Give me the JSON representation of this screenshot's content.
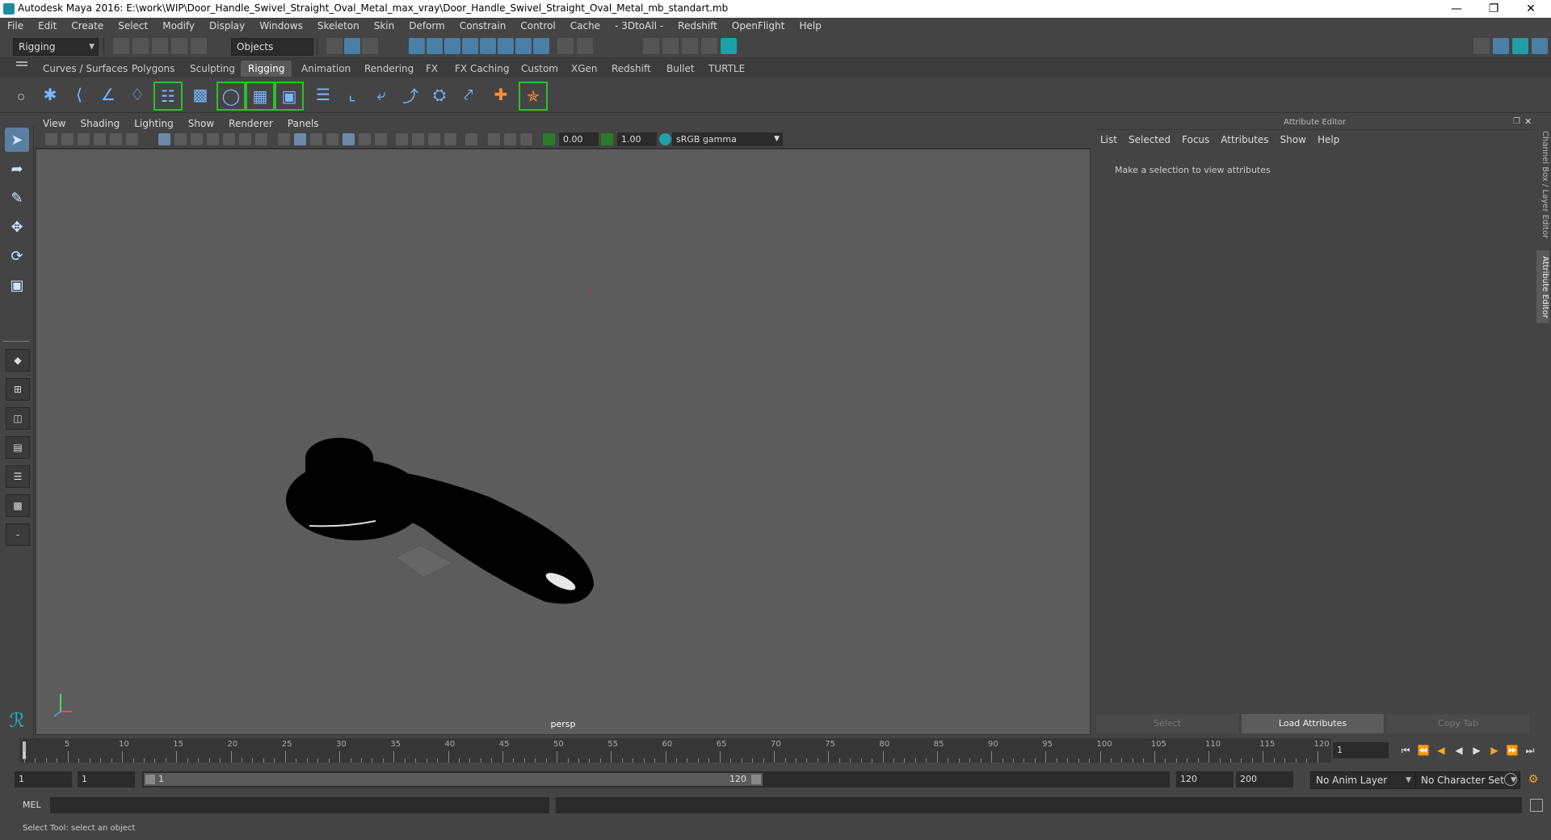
{
  "window": {
    "title": "Autodesk Maya 2016: E:\\work\\WIP\\Door_Handle_Swivel_Straight_Oval_Metal_max_vray\\Door_Handle_Swivel_Straight_Oval_Metal_mb_standart.mb"
  },
  "menubar": [
    "File",
    "Edit",
    "Create",
    "Select",
    "Modify",
    "Display",
    "Windows",
    "Skeleton",
    "Skin",
    "Deform",
    "Constrain",
    "Control",
    "Cache",
    "- 3DtoAll -",
    "Redshift",
    "OpenFlight",
    "Help"
  ],
  "statusline": {
    "menuset": "Rigging",
    "selection_mode": "Objects"
  },
  "shelf_tabs": [
    "Curves / Surfaces",
    "Polygons",
    "Sculpting",
    "Rigging",
    "Animation",
    "Rendering",
    "FX",
    "FX Caching",
    "Custom",
    "XGen",
    "Redshift",
    "Bullet",
    "TURTLE"
  ],
  "active_shelf_tab": "Rigging",
  "viewport": {
    "menu": [
      "View",
      "Shading",
      "Lighting",
      "Show",
      "Renderer",
      "Panels"
    ],
    "exposure": "0.00",
    "gamma": "1.00",
    "colorspace": "sRGB gamma",
    "camera": "persp"
  },
  "attribute_editor": {
    "title": "Attribute Editor",
    "menu": [
      "List",
      "Selected",
      "Focus",
      "Attributes",
      "Show",
      "Help"
    ],
    "message": "Make a selection to view attributes",
    "buttons": {
      "select": "Select",
      "load": "Load Attributes",
      "copy": "Copy Tab"
    }
  },
  "side_tabs": [
    "Channel Box / Layer Editor",
    "Attribute Editor"
  ],
  "timeline": {
    "ticks": [
      "5",
      "10",
      "15",
      "20",
      "25",
      "30",
      "35",
      "40",
      "45",
      "50",
      "55",
      "60",
      "65",
      "70",
      "75",
      "80",
      "85",
      "90",
      "95",
      "100",
      "105",
      "110",
      "115",
      "120"
    ],
    "start_label": "1",
    "current_frame": "1"
  },
  "range": {
    "start": "1",
    "playback_start": "1",
    "slider_start": "1",
    "slider_end": "120",
    "playback_end": "120",
    "end": "200",
    "anim_layer": "No Anim Layer",
    "character_set": "No Character Set"
  },
  "command": {
    "label": "MEL"
  },
  "help_line": "Select Tool: select an object"
}
